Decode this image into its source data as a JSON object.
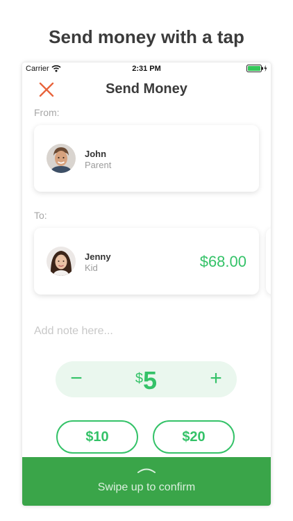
{
  "headline": "Send money with a tap",
  "status_bar": {
    "carrier": "Carrier",
    "time": "2:31 PM"
  },
  "nav": {
    "title": "Send Money",
    "close_icon": "close-x-icon"
  },
  "from": {
    "label": "From:",
    "person": {
      "name": "John",
      "role": "Parent"
    }
  },
  "to": {
    "label": "To:",
    "person": {
      "name": "Jenny",
      "role": "Kid",
      "balance": "$68.00"
    }
  },
  "note": {
    "placeholder": "Add note here..."
  },
  "stepper": {
    "minus": "−",
    "currency": "$",
    "value": "5",
    "plus": "+"
  },
  "quick_amounts": [
    "$10",
    "$20"
  ],
  "confirm": {
    "label": "Swipe up to confirm"
  },
  "colors": {
    "accent": "#34c268",
    "close": "#e8643c",
    "confirm_bar": "#3aa549"
  }
}
